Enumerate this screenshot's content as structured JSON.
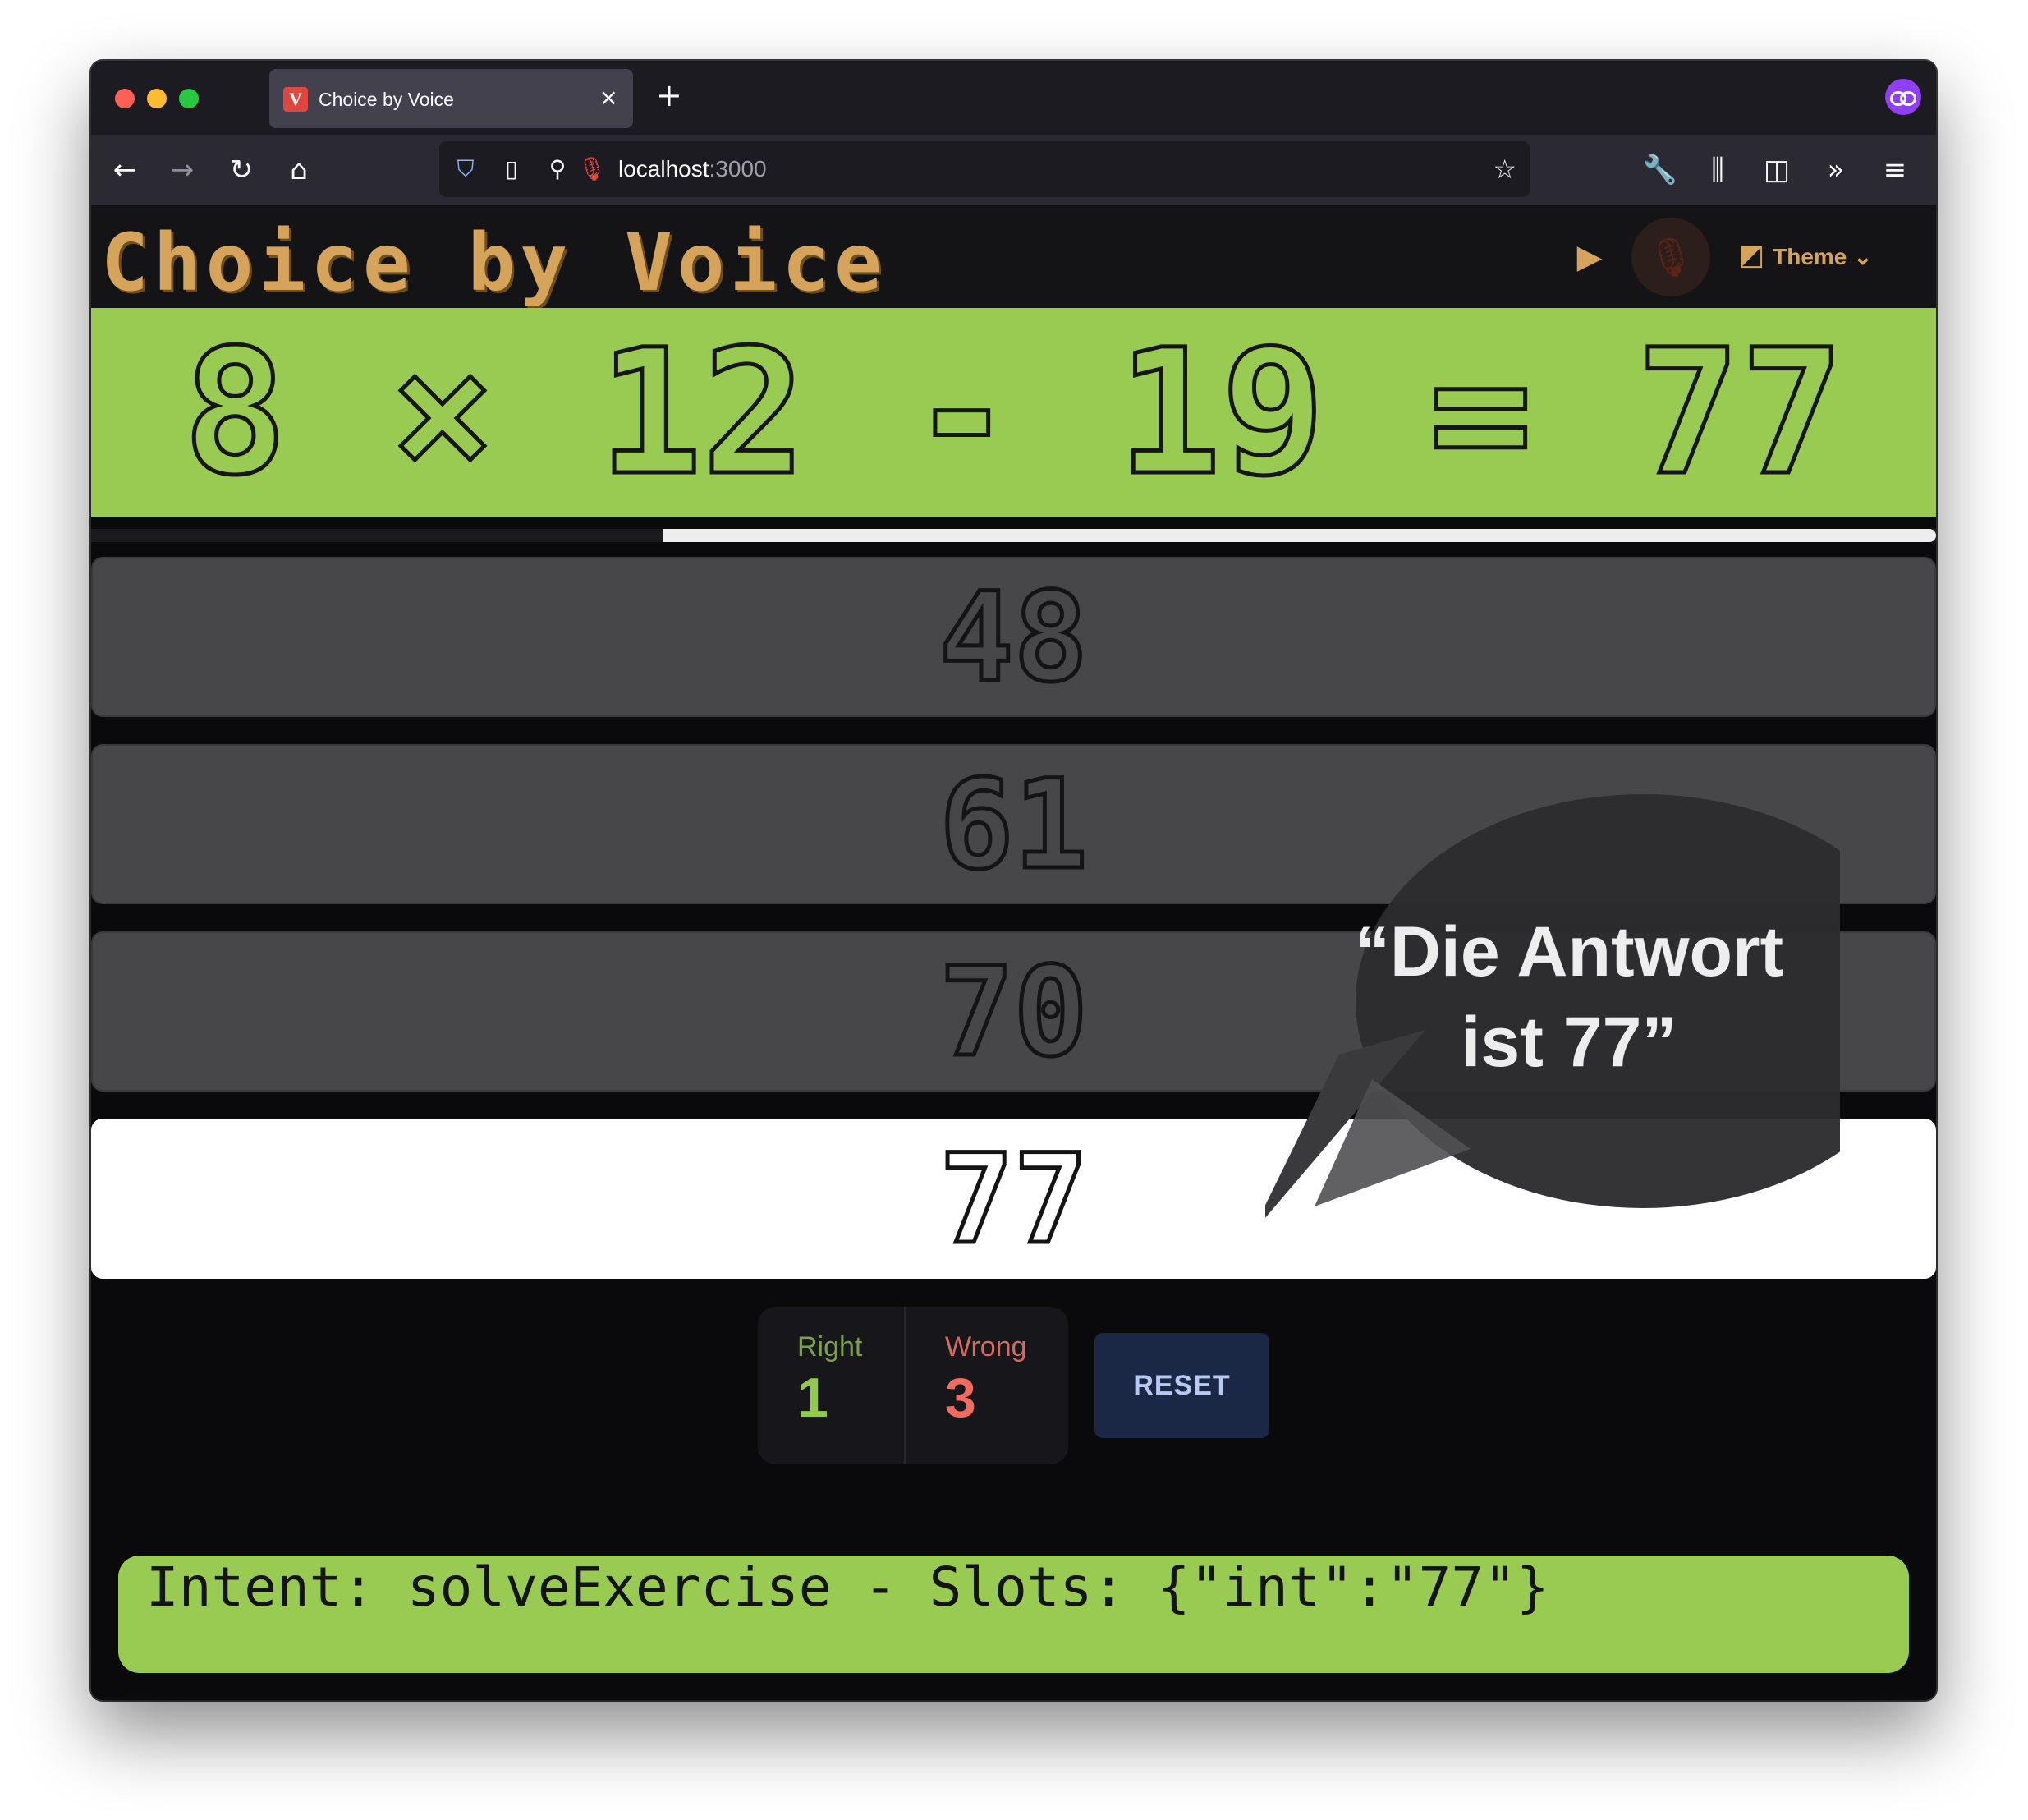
{
  "browser": {
    "tab_title": "Choice by Voice",
    "tab_favicon": "V",
    "tab_close": "×",
    "new_tab": "+",
    "url_host": "localhost",
    "url_port": ":3000"
  },
  "app": {
    "title": "Choice by Voice",
    "theme_label": "Theme",
    "theme_chevron": "⌄"
  },
  "exercise": {
    "equation": "8 × 12 - 19 = 77",
    "progress_percent": 69
  },
  "options": [
    "48",
    "61",
    "70",
    "77"
  ],
  "selected_option": "77",
  "speech_bubble": {
    "line1": "“Die Antwort",
    "line2": "ist 77”"
  },
  "score": {
    "right_label": "Right",
    "right_value": "1",
    "wrong_label": "Wrong",
    "wrong_value": "3"
  },
  "reset_label": "RESET",
  "intent": {
    "text": "Intent: solveExercise - Slots: {\"int\":\"77\"}"
  },
  "colors": {
    "accent_green": "#99cb52",
    "logo_gold": "#d6a35a",
    "wrong_red": "#f06b62",
    "reset_bg": "#1a2745"
  },
  "icons": {
    "back": "back-arrow-icon",
    "forward": "forward-arrow-icon",
    "reload": "reload-icon",
    "home": "home-icon",
    "video": "video-icon",
    "microphone": "microphone-icon",
    "theme": "theme-palette-icon"
  }
}
